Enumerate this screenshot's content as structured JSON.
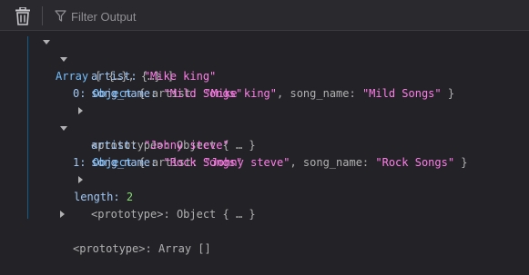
{
  "toolbar": {
    "clear_icon": "trash-icon",
    "filter_icon": "funnel-icon",
    "filter_placeholder": "Filter Output"
  },
  "console": {
    "root": {
      "label": "Array",
      "preview": "[ {…}, {…} ]"
    },
    "items": [
      {
        "index": "0:",
        "type": "Object",
        "summary_open": "{ artist: ",
        "summary_artist": "\"Mike king\"",
        "summary_mid": ", song_name: ",
        "summary_song": "\"Mild Songs\"",
        "summary_close": " }",
        "artist_key": "artist:",
        "artist_value": "\"Mike king\"",
        "song_key": "song_name:",
        "song_value": "\"Mild Songs\"",
        "prototype_key": "<prototype>:",
        "prototype_value": "Object { … }"
      },
      {
        "index": "1:",
        "type": "Object",
        "summary_open": "{ artist: ",
        "summary_artist": "\"Johny steve\"",
        "summary_mid": ", song_name: ",
        "summary_song": "\"Rock Songs\"",
        "summary_close": " }",
        "artist_key": "artist:",
        "artist_value": "\"Johny steve\"",
        "song_key": "song_name:",
        "song_value": "\"Rock Songs\"",
        "prototype_key": "<prototype>:",
        "prototype_value": "Object { … }"
      }
    ],
    "length_key": "length:",
    "length_value": "2",
    "root_prototype_key": "<prototype>:",
    "root_prototype_value": "Array []"
  },
  "colors": {
    "background": "#232327",
    "string": "#ff7de9",
    "object_label": "#75bfff",
    "number": "#86de74",
    "guide": "#0c5f8a"
  }
}
